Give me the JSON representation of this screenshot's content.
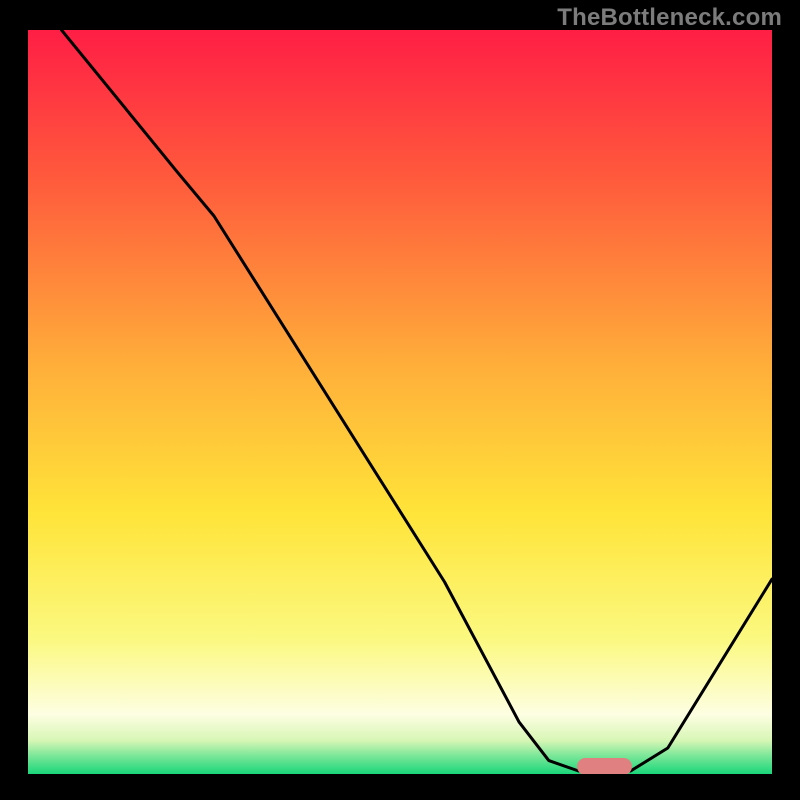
{
  "watermark": "TheBottleneck.com",
  "chart_data": {
    "type": "line",
    "title": "",
    "xlabel": "",
    "ylabel": "",
    "xlim": [
      0,
      1
    ],
    "ylim": [
      0,
      1
    ],
    "gradient_stops": [
      {
        "offset": 0.0,
        "color": "#ff1e45"
      },
      {
        "offset": 0.2,
        "color": "#ff5a3c"
      },
      {
        "offset": 0.45,
        "color": "#ffae3a"
      },
      {
        "offset": 0.65,
        "color": "#ffe439"
      },
      {
        "offset": 0.82,
        "color": "#fbf981"
      },
      {
        "offset": 0.92,
        "color": "#fdfee2"
      },
      {
        "offset": 0.955,
        "color": "#d7f6b5"
      },
      {
        "offset": 0.975,
        "color": "#7de799"
      },
      {
        "offset": 1.0,
        "color": "#1ad67b"
      }
    ],
    "series": [
      {
        "name": "bottleneck-curve",
        "points": [
          {
            "x": 0.045,
            "y": 1.0
          },
          {
            "x": 0.2,
            "y": 0.81
          },
          {
            "x": 0.25,
            "y": 0.75
          },
          {
            "x": 0.56,
            "y": 0.258
          },
          {
            "x": 0.66,
            "y": 0.07
          },
          {
            "x": 0.7,
            "y": 0.018
          },
          {
            "x": 0.74,
            "y": 0.004
          },
          {
            "x": 0.81,
            "y": 0.004
          },
          {
            "x": 0.86,
            "y": 0.035
          },
          {
            "x": 1.0,
            "y": 0.262
          }
        ],
        "stroke": "#000000",
        "stroke_width": 3
      }
    ],
    "marker": {
      "name": "optimal-range",
      "x_center": 0.775,
      "y_center": 0.01,
      "width_norm": 0.075,
      "height_norm": 0.024,
      "color": "#e08080"
    }
  }
}
